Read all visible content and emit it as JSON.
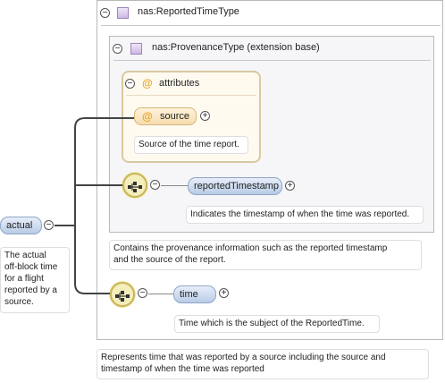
{
  "root": {
    "label": "actual",
    "doc": [
      "The actual",
      "off-block time",
      "for a flight",
      "reported by a",
      "source."
    ]
  },
  "outer_type": {
    "name": "nas:ReportedTimeType",
    "doc": [
      "Represents time that was reported by a source including the source and",
      "timestamp of when the time was reported"
    ]
  },
  "base_type": {
    "name": "nas:ProvenanceType (extension base)",
    "doc": [
      "Contains the provenance information such as the reported timestamp",
      "and the source of the report."
    ]
  },
  "attributes": {
    "title": "attributes",
    "source_label": "source",
    "source_doc": "Source of the time report."
  },
  "reported_timestamp": {
    "label": "reportedTimestamp",
    "doc": "Indicates the timestamp of when the time was reported."
  },
  "time": {
    "label": "time",
    "doc": "Time which is the subject of the ReportedTime."
  },
  "icons": {
    "collapse": "−",
    "expand": "+",
    "attribute": "@"
  },
  "colors": {
    "element_fill": "#c9d8ee",
    "attribute_fill": "#fdf0d6",
    "sequence_fill": "#f3eebc",
    "type_icon": "#c9b4e0"
  }
}
